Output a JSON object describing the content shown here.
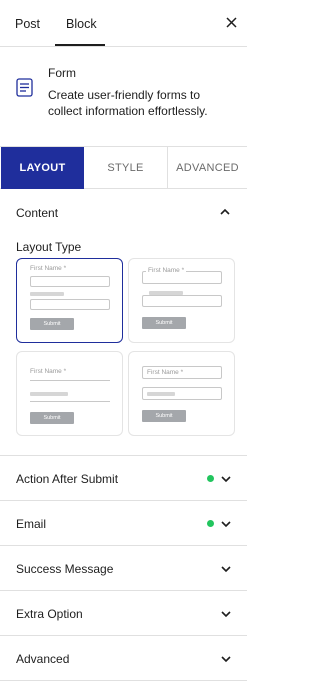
{
  "top_tabs": {
    "post": "Post",
    "block": "Block"
  },
  "block": {
    "icon": "form-icon",
    "title": "Form",
    "description": "Create user-friendly forms to collect information effortlessly."
  },
  "sub_tabs": {
    "layout": "LAYOUT",
    "style": "STYLE",
    "advanced": "ADVANCED"
  },
  "content": {
    "title": "Content",
    "layout_type_label": "Layout Type",
    "preview": {
      "field_label": "First Name *",
      "submit": "Submit"
    }
  },
  "accordion": [
    {
      "label": "Action After Submit",
      "status_dot": true
    },
    {
      "label": "Email",
      "status_dot": true
    },
    {
      "label": "Success Message",
      "status_dot": false
    },
    {
      "label": "Extra Option",
      "status_dot": false
    },
    {
      "label": "Advanced",
      "status_dot": false
    }
  ],
  "colors": {
    "accent": "#1f2e9c",
    "status_dot": "#22c55e"
  }
}
